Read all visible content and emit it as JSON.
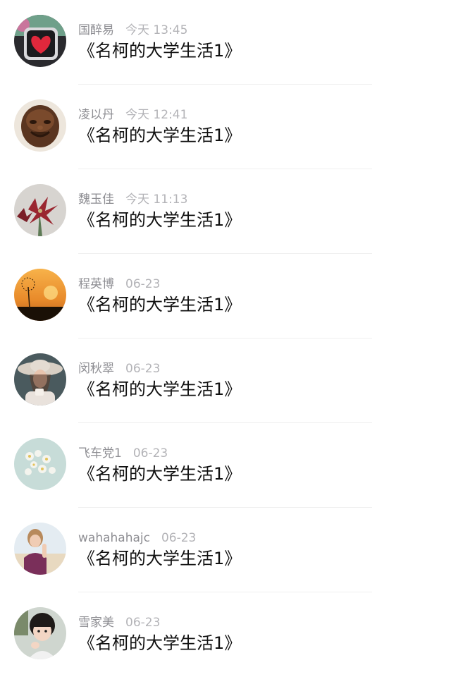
{
  "comments": [
    {
      "name": "国醉易",
      "time": "今天 13:45",
      "text": "《名柯的大学生活1》",
      "avatar": "heart-photo-avatar"
    },
    {
      "name": "凌以丹",
      "time": "今天 12:41",
      "text": "《名柯的大学生活1》",
      "avatar": "laughing-buddha-avatar"
    },
    {
      "name": "魏玉佳",
      "time": "今天 11:13",
      "text": "《名柯的大学生活1》",
      "avatar": "red-flowers-avatar"
    },
    {
      "name": "程英博",
      "time": "06-23",
      "text": "《名柯的大学生活1》",
      "avatar": "dandelion-sunset-avatar"
    },
    {
      "name": "闵秋翠",
      "time": "06-23",
      "text": "《名柯的大学生活1》",
      "avatar": "woman-hat-avatar"
    },
    {
      "name": "飞车党1",
      "time": "06-23",
      "text": "《名柯的大学生活1》",
      "avatar": "white-flowers-avatar"
    },
    {
      "name": "wahahahajc",
      "time": "06-23",
      "text": "《名柯的大学生活1》",
      "avatar": "girl-beach-avatar"
    },
    {
      "name": "雪家美",
      "time": "06-23",
      "text": "《名柯的大学生活1》",
      "avatar": "child-photo-avatar"
    }
  ],
  "colors": {
    "name_text": "#8e8e93",
    "time_text": "#b3b3b7",
    "title_text": "#111111",
    "divider": "#efefef"
  }
}
